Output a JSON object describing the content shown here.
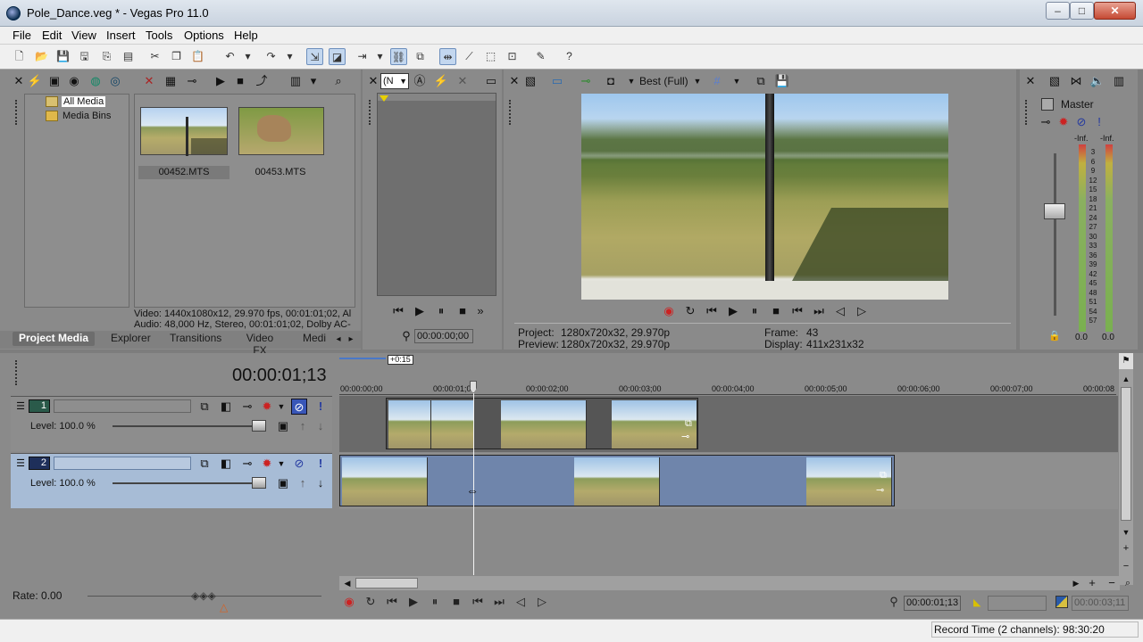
{
  "window": {
    "title": "Pole_Dance.veg * - Vegas Pro 11.0",
    "min": "–",
    "max": "□",
    "close": "✕"
  },
  "menu": [
    "File",
    "Edit",
    "View",
    "Insert",
    "Tools",
    "Options",
    "Help"
  ],
  "project_media": {
    "tree": [
      "All Media",
      "Media Bins"
    ],
    "files": [
      {
        "name": "00452.MTS"
      },
      {
        "name": "00453.MTS"
      }
    ],
    "info_video": "Video: 1440x1080x12, 29.970 fps, 00:01:01;02, Al",
    "info_audio": "Audio: 48,000 Hz, Stereo, 00:01:01;02, Dolby AC-",
    "tabs": [
      "Project Media",
      "Explorer",
      "Transitions",
      "Video FX",
      "Medi"
    ]
  },
  "trimmer": {
    "dropdown": "(N",
    "time": "00:00:00;00"
  },
  "preview": {
    "quality": "Best (Full)",
    "project_label": "Project:",
    "project_value": "1280x720x32, 29.970p",
    "preview_label": "Preview:",
    "preview_value": "1280x720x32, 29.970p",
    "frame_label": "Frame:",
    "frame_value": "43",
    "display_label": "Display:",
    "display_value": "411x231x32"
  },
  "master": {
    "title": "Master",
    "left_peak": "-Inf.",
    "right_peak": "-Inf.",
    "scale": [
      "3",
      "6",
      "9",
      "12",
      "15",
      "18",
      "21",
      "24",
      "27",
      "30",
      "33",
      "36",
      "39",
      "42",
      "45",
      "48",
      "51",
      "54",
      "57"
    ],
    "left_level": "0.0",
    "right_level": "0.0"
  },
  "timeline": {
    "cursor_time": "00:00:01;13",
    "loop_marker": "+0:15",
    "ruler": [
      "00:00:00;00",
      "00:00:01;0",
      "00:00:02;00",
      "00:00:03;00",
      "00:00:04;00",
      "00:00:05;00",
      "00:00:06;00",
      "00:00:07;00",
      "00:00:08"
    ],
    "tracks": [
      {
        "number": "1",
        "level": "Level: 100.0 %"
      },
      {
        "number": "2",
        "level": "Level: 100.0 %"
      }
    ],
    "rate": "Rate: 0.00",
    "transport_time": "00:00:01;13",
    "end_time": "00:00:03;11",
    "record_time": "Record Time (2 channels): 98:30:20"
  }
}
